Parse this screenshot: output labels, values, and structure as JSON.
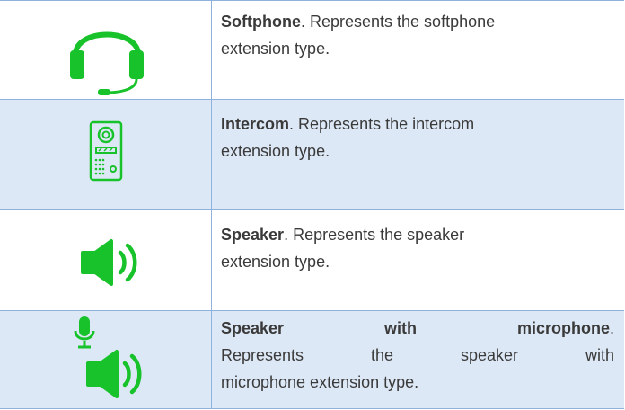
{
  "rows": [
    {
      "title": "Softphone",
      "desc_line1": ". Represents the softphone",
      "desc_line2": "extension type.",
      "icon": "headset-icon"
    },
    {
      "title": "Intercom",
      "desc_line1": ". Represents the intercom",
      "desc_line2": "extension type.",
      "icon": "intercom-icon"
    },
    {
      "title": "Speaker",
      "desc_line1": ". Represents the speaker",
      "desc_line2": "extension type.",
      "icon": "speaker-icon"
    },
    {
      "title": "Speaker with microphone",
      "title_w1": "Speaker",
      "title_w2": "with",
      "title_w3": "microphone",
      "period": ".",
      "desc_line2": "Represents the speaker with",
      "desc_line3": "microphone extension type.",
      "icon": "speaker-microphone-icon"
    }
  ],
  "colors": {
    "icon_green": "#18c22a",
    "row_alt": "#dde8f6",
    "border": "#8fb2dd"
  }
}
